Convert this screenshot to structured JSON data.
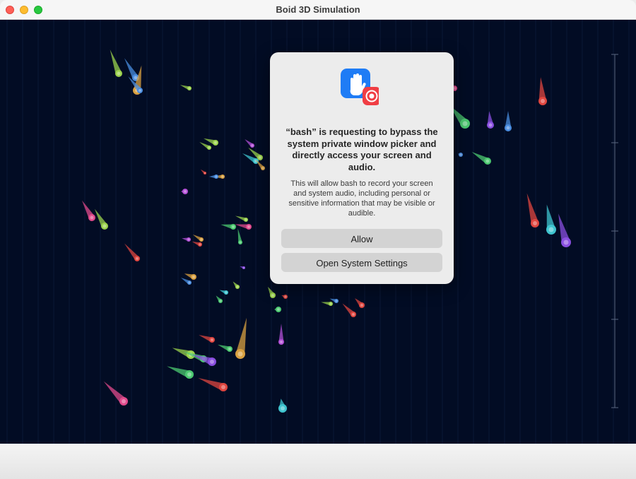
{
  "window": {
    "title": "Boid 3D Simulation"
  },
  "dialog": {
    "heading": "“bash” is requesting to bypass the system private window picker and directly access your screen and audio.",
    "body": "This will allow bash to record your screen and system audio, including personal or sensitive information that may be visible or audible.",
    "allow_label": "Allow",
    "settings_label": "Open System Settings"
  },
  "simulation": {
    "background_color": "#020c24",
    "boid_colors": [
      "#e14a8c",
      "#9bd24c",
      "#4a8de0",
      "#d9a040",
      "#4cc970",
      "#e0463f",
      "#3fc4cf",
      "#8a4fe0",
      "#b24fd6"
    ]
  }
}
